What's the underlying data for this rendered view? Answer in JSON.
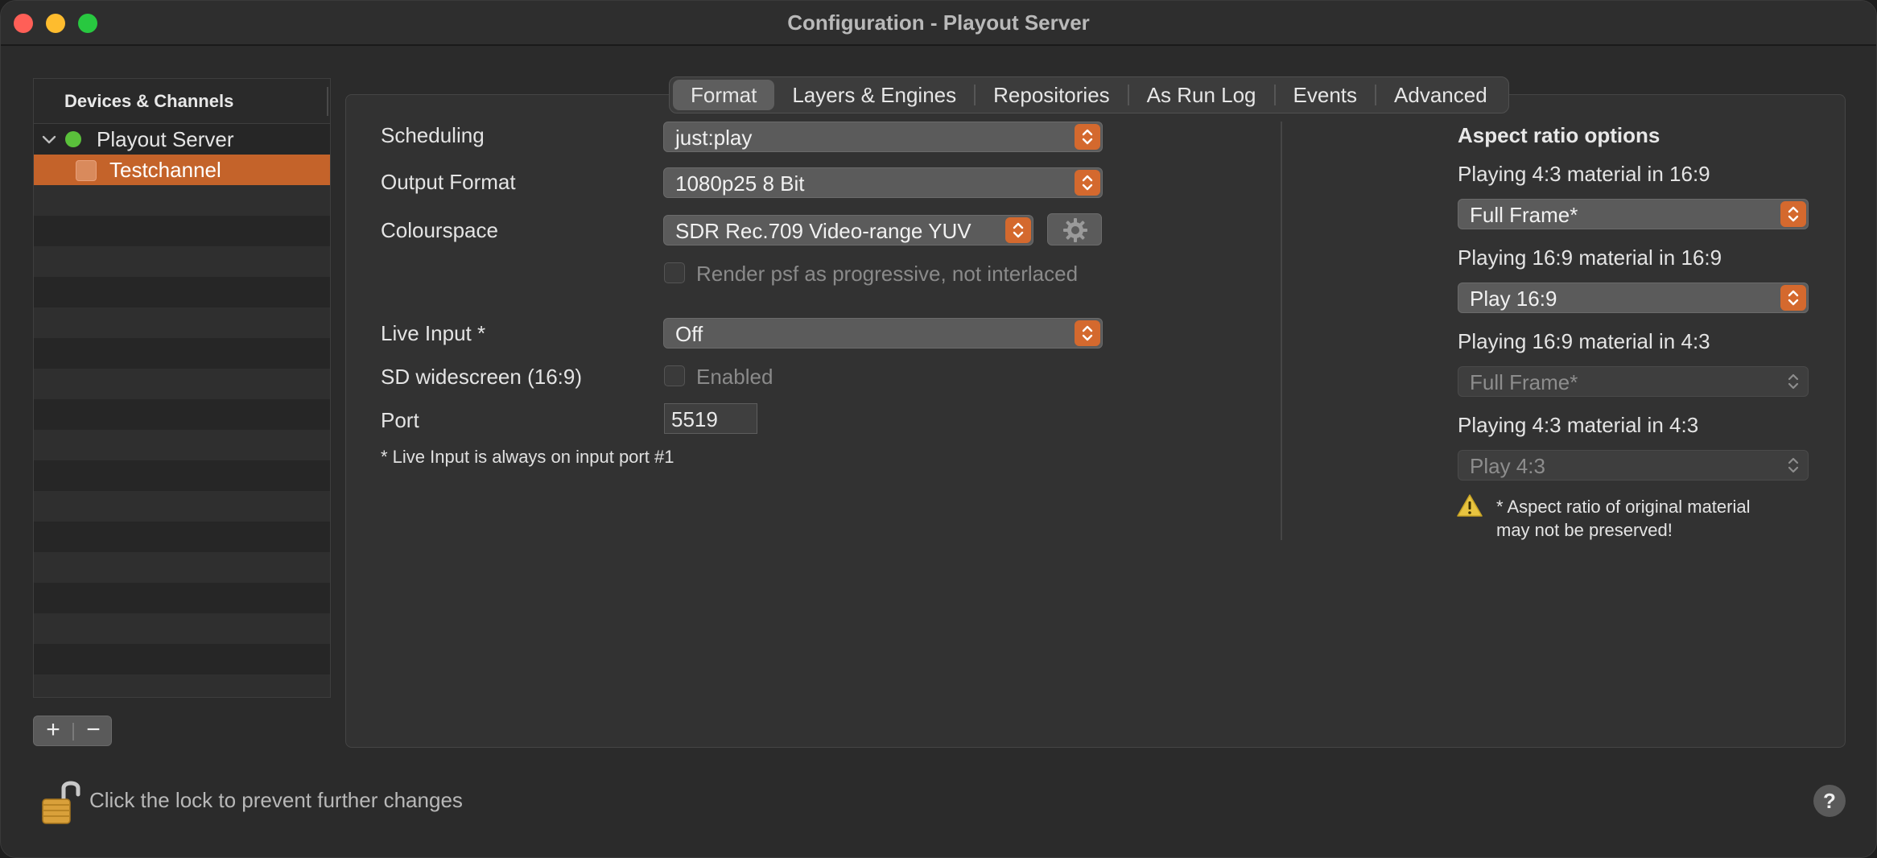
{
  "window": {
    "title": "Configuration - Playout Server"
  },
  "sidebar": {
    "header": "Devices & Channels",
    "server": {
      "label": "Playout Server",
      "status_color": "#5ac13b"
    },
    "channel": {
      "label": "Testchannel"
    },
    "add_label": "+",
    "remove_label": "−"
  },
  "tabs": [
    {
      "label": "Format",
      "active": true
    },
    {
      "label": "Layers & Engines"
    },
    {
      "label": "Repositories"
    },
    {
      "label": "As Run Log"
    },
    {
      "label": "Events"
    },
    {
      "label": "Advanced"
    }
  ],
  "format": {
    "scheduling": {
      "label": "Scheduling",
      "value": "just:play"
    },
    "output_format": {
      "label": "Output Format",
      "value": "1080p25 8 Bit"
    },
    "colourspace": {
      "label": "Colourspace",
      "value": "SDR Rec.709 Video-range YUV"
    },
    "render_psf": {
      "label": "Render psf as progressive, not interlaced"
    },
    "live_input": {
      "label": "Live Input *",
      "value": "Off"
    },
    "sd_widescreen": {
      "label": "SD widescreen (16:9)",
      "checkbox_label": "Enabled"
    },
    "port": {
      "label": "Port",
      "value": "5519"
    },
    "note": "* Live Input is always on input port #1"
  },
  "aspect": {
    "title": "Aspect ratio options",
    "options": [
      {
        "label": "Playing 4:3 material in 16:9",
        "value": "Full Frame*"
      },
      {
        "label": "Playing 16:9 material in 16:9",
        "value": "Play 16:9"
      },
      {
        "label": "Playing 16:9 material in 4:3",
        "value": "Full Frame*"
      },
      {
        "label": "Playing 4:3 material in 4:3",
        "value": "Play 4:3"
      }
    ],
    "warning_line1": "* Aspect ratio of original material",
    "warning_line2": "may not be preserved!"
  },
  "footer": {
    "lock_text": "Click the lock to prevent further changes",
    "help_label": "?"
  },
  "colors": {
    "accent": "#d4692e",
    "selection": "#c4632a"
  }
}
